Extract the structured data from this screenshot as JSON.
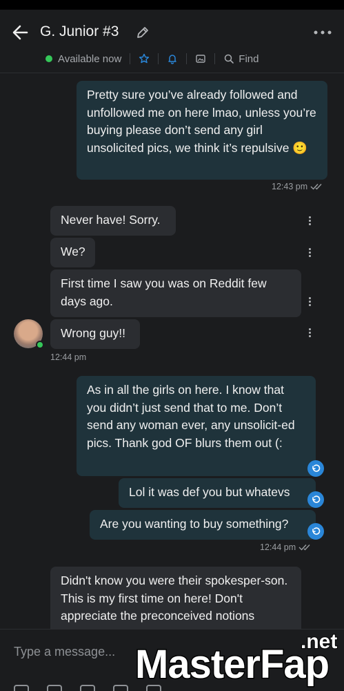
{
  "header": {
    "title": "G. Junior #3",
    "status": "Available now",
    "find_label": "Find"
  },
  "messages": [
    {
      "id": "m1",
      "dir": "out",
      "text": "Pretty sure you’ve already followed and unfollowed me on here lmao, unless you’re buying please don’t send any girl unsolicited pics, we think it’s repulsive 🙂"
    },
    {
      "id": "m2",
      "dir": "in",
      "text": "Never have! Sorry."
    },
    {
      "id": "m3",
      "dir": "in",
      "text": "We?"
    },
    {
      "id": "m4",
      "dir": "in",
      "text": "First time I saw you was on Reddit few days ago."
    },
    {
      "id": "m5",
      "dir": "in",
      "text": "Wrong guy!!"
    },
    {
      "id": "m6",
      "dir": "out",
      "text": "As in all the girls on here. I know that you didn’t just send that to me. Don’t send any woman ever, any unsolicit-ed pics. Thank god OF blurs them out (:"
    },
    {
      "id": "m7",
      "dir": "out",
      "text": "Lol it was def you but whatevs"
    },
    {
      "id": "m8",
      "dir": "out",
      "text": "Are you wanting to buy something?"
    },
    {
      "id": "m9",
      "dir": "in",
      "text": "Didn't know you were their spokesper-son. This is my first time on here! Don't appreciate the preconceived notions"
    }
  ],
  "timestamps": {
    "t1": "12:43 pm",
    "t2": "12:44 pm",
    "t3": "12:44 pm"
  },
  "composer": {
    "placeholder": "Type a message..."
  },
  "watermark": {
    "main": "MasterFap",
    "sub": ".net"
  },
  "colors": {
    "outgoing_bubble": "#1f333b",
    "incoming_bubble": "#2b2d31",
    "accent": "#2a86d8",
    "online": "#35c759"
  }
}
